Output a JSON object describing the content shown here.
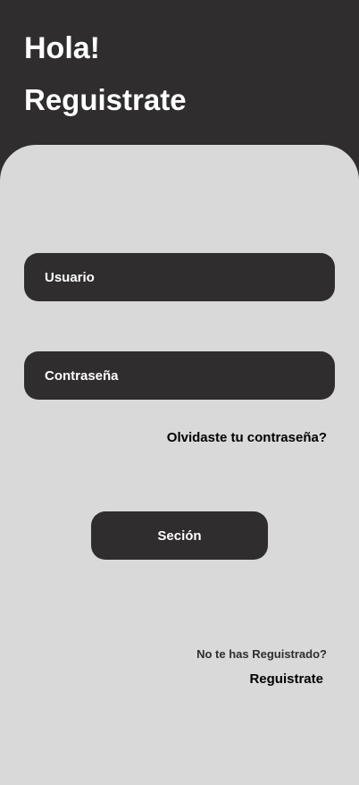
{
  "header": {
    "greeting": "Hola!",
    "title": "Reguistrate"
  },
  "form": {
    "username_placeholder": "Usuario",
    "password_placeholder": "Contraseña",
    "forgot_password": "Olvidaste tu contraseña?",
    "submit_label": "Seción"
  },
  "footer": {
    "no_account": "No te has Reguistrado?",
    "register_link": "Reguistrate"
  },
  "colors": {
    "dark": "#2f2d2e",
    "panel": "#d9d9d9",
    "text_light": "#ffffff",
    "text_dark": "#000000"
  }
}
